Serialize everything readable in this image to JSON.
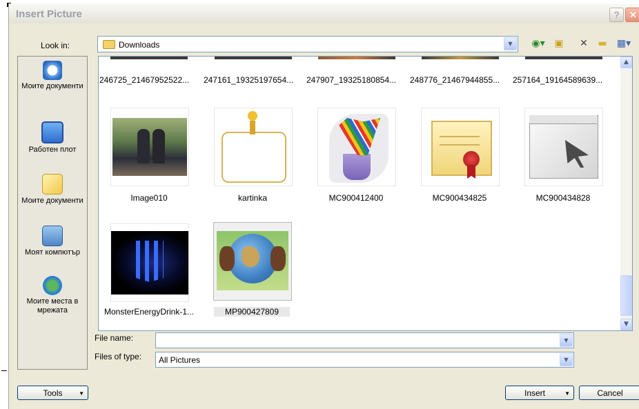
{
  "dialog": {
    "title": "Insert Picture",
    "help_glyph": "?",
    "close_glyph": "✕"
  },
  "lookin": {
    "label": "Look in:",
    "value": "Downloads"
  },
  "places": [
    {
      "label": "Моите документи",
      "icon": "recent-documents-icon"
    },
    {
      "label": "Работен плот",
      "icon": "desktop-icon"
    },
    {
      "label": "Моите документи",
      "icon": "my-documents-icon"
    },
    {
      "label": "Моят компютър",
      "icon": "my-computer-icon"
    },
    {
      "label": "Моите места в мрежата",
      "icon": "network-places-icon"
    }
  ],
  "files": {
    "top_row": [
      "246725_21467952522...",
      "247161_19325197654...",
      "247907_19325180854...",
      "248776_21467944855...",
      "257164_19164589639..."
    ],
    "row1": [
      "Image010",
      "kartinka",
      "MC900412400",
      "MC900434825",
      "MC900434828"
    ],
    "row2": [
      "MonsterEnergyDrink-1...",
      "MP900427809"
    ]
  },
  "filename": {
    "label": "File name:",
    "value": ""
  },
  "filetype": {
    "label": "Files of type:",
    "value": "All Pictures"
  },
  "buttons": {
    "tools": "Tools",
    "insert": "Insert",
    "cancel": "Cancel"
  }
}
